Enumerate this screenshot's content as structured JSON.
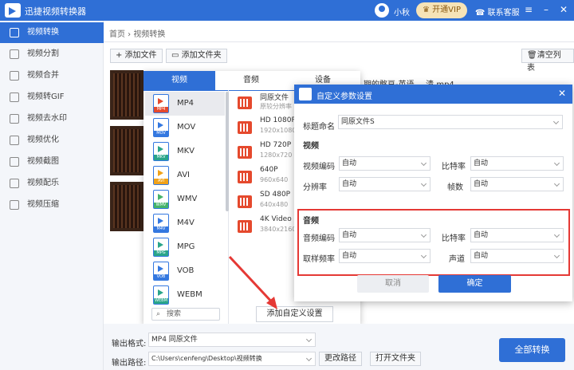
{
  "app": {
    "title": "迅捷视频转换器",
    "user": "小秋",
    "vip": "开通VIP",
    "service": "联系客服"
  },
  "sidebar": {
    "items": [
      "视频转换",
      "视频分割",
      "视频合并",
      "视频转GIF",
      "视频去水印",
      "视频优化",
      "视频截图",
      "视频配乐",
      "视频压缩"
    ]
  },
  "breadcrumb": "首页 › 视频转换",
  "toolbar": {
    "add_file": "+ 添加文件",
    "add_folder": "添加文件夹",
    "clear_list": "清空列表"
  },
  "file": {
    "name_partial": "期的憨豆-英语_...清.mp4"
  },
  "format_panel": {
    "tabs": [
      "视频",
      "音频",
      "设备"
    ],
    "formats": [
      {
        "name": "MP4",
        "badge": "MP4",
        "color": "#e5492d"
      },
      {
        "name": "MOV",
        "badge": "MOV",
        "color": "#3478e0"
      },
      {
        "name": "MKV",
        "badge": "MKV",
        "color": "#2aa58a"
      },
      {
        "name": "AVI",
        "badge": "AVI",
        "color": "#f0a21a"
      },
      {
        "name": "WMV",
        "badge": "WMV",
        "color": "#45b36b"
      },
      {
        "name": "M4V",
        "badge": "M4V",
        "color": "#3478e0"
      },
      {
        "name": "MPG",
        "badge": "MPG",
        "color": "#2aa58a"
      },
      {
        "name": "VOB",
        "badge": "VOB",
        "color": "#3478e0"
      },
      {
        "name": "WEBM",
        "badge": "WEBM",
        "color": "#2aa58a"
      }
    ],
    "qualities": [
      {
        "name": "同原文件",
        "sub": "原较分辨率"
      },
      {
        "name": "HD 1080P",
        "sub": "1920x1080"
      },
      {
        "name": "HD 720P",
        "sub": "1280x720"
      },
      {
        "name": "640P",
        "sub": "960x640"
      },
      {
        "name": "SD 480P",
        "sub": "640x480"
      },
      {
        "name": "4K Video",
        "sub": "3840x2160"
      }
    ],
    "search_placeholder": "搜索",
    "add_custom": "添加自定义设置"
  },
  "dialog": {
    "title": "自定义参数设置",
    "name_label": "标题命名",
    "name_value": "同原文件S",
    "video_section": "视频",
    "video_codec_label": "视频编码",
    "video_codec": "自动",
    "bitrate_label": "比特率",
    "bitrate": "自动",
    "resolution_label": "分辨率",
    "resolution": "自动",
    "framerate_label": "帧数",
    "framerate": "自动",
    "audio_section": "音频",
    "audio_codec_label": "音频编码",
    "audio_codec": "自动",
    "audio_bitrate_label": "比特率",
    "audio_bitrate": "自动",
    "samplerate_label": "取样频率",
    "samplerate": "自动",
    "channel_label": "声道",
    "channel": "自动",
    "cancel": "取消",
    "ok": "确定"
  },
  "bottom": {
    "format_label": "输出格式:",
    "format_value": "MP4 同原文件",
    "path_label": "输出路径:",
    "path_value": "C:\\Users\\cenfeng\\Desktop\\视频转换",
    "change_dir": "更改路径",
    "open_folder": "打开文件夹",
    "convert_all": "全部转换"
  }
}
